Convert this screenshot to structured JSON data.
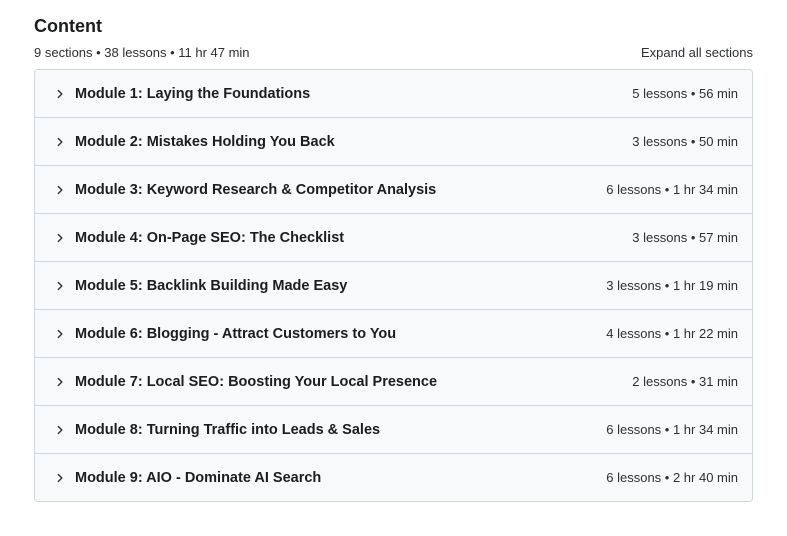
{
  "header": {
    "title": "Content",
    "summary": "9 sections • 38 lessons • 11 hr 47 min",
    "expand_label": "Expand all sections"
  },
  "sections": [
    {
      "title": "Module 1: Laying the Foundations",
      "meta": "5 lessons • 56 min"
    },
    {
      "title": "Module 2: Mistakes Holding You Back",
      "meta": "3 lessons • 50 min"
    },
    {
      "title": "Module 3: Keyword Research & Competitor Analysis",
      "meta": "6 lessons • 1 hr 34 min"
    },
    {
      "title": "Module 4: On-Page SEO: The Checklist",
      "meta": "3 lessons • 57 min"
    },
    {
      "title": "Module 5: Backlink Building Made Easy",
      "meta": "3 lessons • 1 hr 19 min"
    },
    {
      "title": "Module 6: Blogging - Attract Customers to You",
      "meta": "4 lessons • 1 hr 22 min"
    },
    {
      "title": "Module 7: Local SEO: Boosting Your Local Presence",
      "meta": "2 lessons • 31 min"
    },
    {
      "title": "Module 8: Turning Traffic into Leads & Sales",
      "meta": "6 lessons • 1 hr 34 min"
    },
    {
      "title": "Module 9: AIO - Dominate AI Search",
      "meta": "6 lessons • 2 hr 40 min"
    }
  ],
  "icons": {
    "section_toggle": "chevron-right-icon"
  }
}
